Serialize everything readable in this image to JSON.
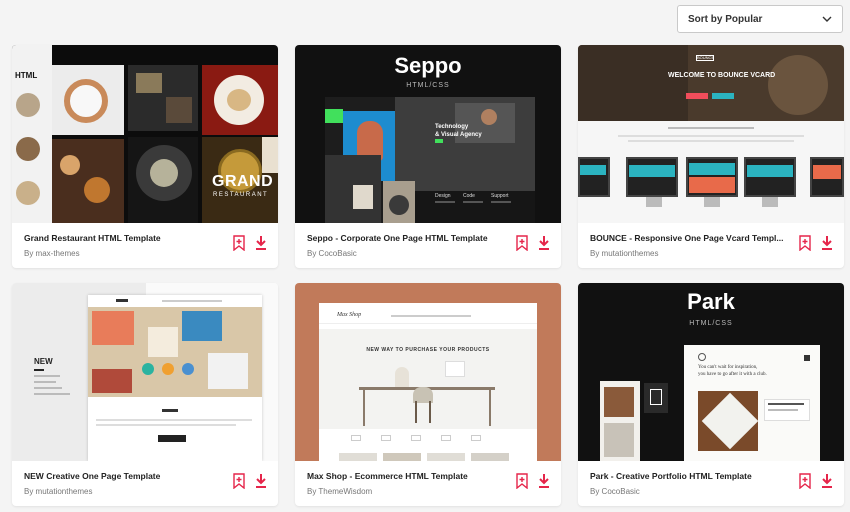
{
  "sort": {
    "label": "Sort by Popular"
  },
  "accent": "#e5254a",
  "cards": [
    {
      "title": "Grand Restaurant HTML Template",
      "author": "By max-themes",
      "preview": {
        "logo": "HTML",
        "brand_1": "GRAND",
        "brand_2": "RESTAURANT"
      }
    },
    {
      "title": "Seppo - Corporate One Page HTML Template",
      "author": "By CocoBasic",
      "preview": {
        "heading": "Seppo",
        "sub": "HTML/CSS",
        "tag_1": "Technology",
        "tag_2": "& Visual Agency",
        "col_1": "Design",
        "col_2": "Code",
        "col_3": "Support"
      }
    },
    {
      "title": "BOUNCE - Responsive One Page Vcard Templ...",
      "author": "By mutationthemes",
      "preview": {
        "badge": "BOUNCE",
        "heading": "WELCOME TO BOUNCE VCARD"
      }
    },
    {
      "title": "NEW Creative One Page Template",
      "author": "By mutationthemes",
      "preview": {
        "label": "NEW"
      }
    },
    {
      "title": "Max Shop - Ecommerce HTML Template",
      "author": "By ThemeWisdom",
      "preview": {
        "logo": "Max Shop",
        "heading": "NEW WAY TO PURCHASE YOUR PRODUCTS"
      }
    },
    {
      "title": "Park - Creative Portfolio HTML Template",
      "author": "By CocoBasic",
      "preview": {
        "heading": "Park",
        "sub": "HTML/CSS",
        "quote_1": "You can't wait for inspiration,",
        "quote_2": "you have to go after it with a club."
      }
    }
  ]
}
